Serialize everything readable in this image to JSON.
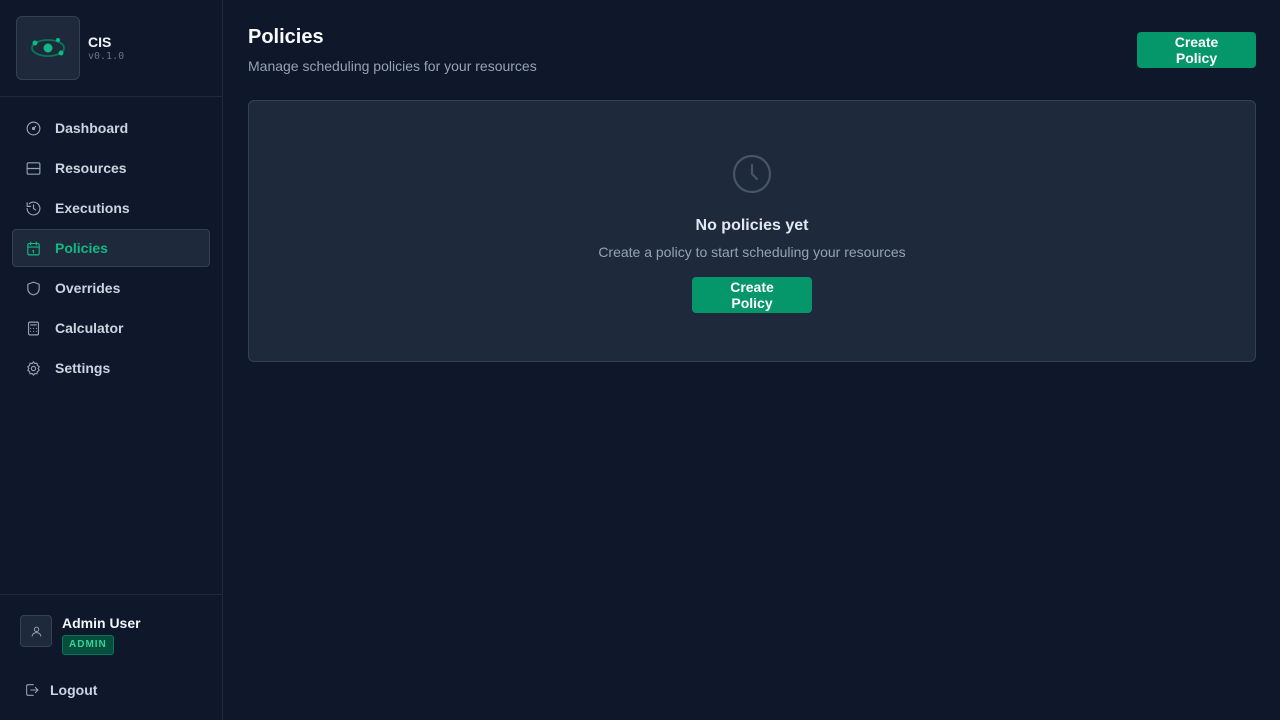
{
  "app": {
    "name": "CIS",
    "version": "v0.1.0"
  },
  "sidebar": {
    "items": [
      {
        "label": "Dashboard",
        "icon": "dashboard-icon",
        "active": false
      },
      {
        "label": "Resources",
        "icon": "server-icon",
        "active": false
      },
      {
        "label": "Executions",
        "icon": "history-icon",
        "active": false
      },
      {
        "label": "Policies",
        "icon": "calendar-icon",
        "active": true
      },
      {
        "label": "Overrides",
        "icon": "shield-icon",
        "active": false
      },
      {
        "label": "Calculator",
        "icon": "calculator-icon",
        "active": false
      },
      {
        "label": "Settings",
        "icon": "gear-icon",
        "active": false
      }
    ]
  },
  "user": {
    "name": "Admin User",
    "role": "ADMIN",
    "logout_label": "Logout"
  },
  "page": {
    "title": "Policies",
    "subtitle": "Manage scheduling policies for your resources",
    "create_button": "Create Policy"
  },
  "empty_state": {
    "icon": "clock-icon",
    "title": "No policies yet",
    "text": "Create a policy to start scheduling your resources",
    "button": "Create Policy"
  },
  "colors": {
    "background": "#0f172a",
    "card": "#1e293b",
    "accent": "#059669",
    "active_text": "#10b981"
  }
}
